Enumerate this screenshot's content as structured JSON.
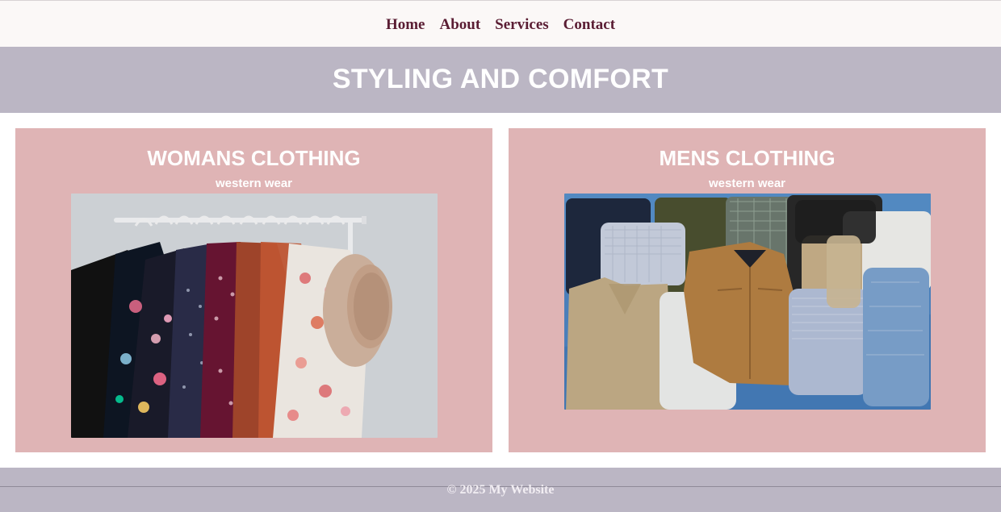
{
  "nav": {
    "items": [
      {
        "label": "Home"
      },
      {
        "label": "About"
      },
      {
        "label": "Services"
      },
      {
        "label": "Contact"
      }
    ]
  },
  "hero": {
    "title": "STYLING AND COMFORT"
  },
  "cards": [
    {
      "title": "WOMANS CLOTHING",
      "subtitle": "western wear",
      "image": "women-clothes-rack-photo"
    },
    {
      "title": "MENS CLOTHING",
      "subtitle": "western wear",
      "image": "men-clothes-flatlay-photo"
    }
  ],
  "footer": {
    "text": "© 2025 My Website"
  },
  "colors": {
    "nav_text": "#5a1d33",
    "banner_bg": "#bbb6c4",
    "card_bg": "#dfb4b5",
    "footer_bg": "#bbb6c4"
  }
}
